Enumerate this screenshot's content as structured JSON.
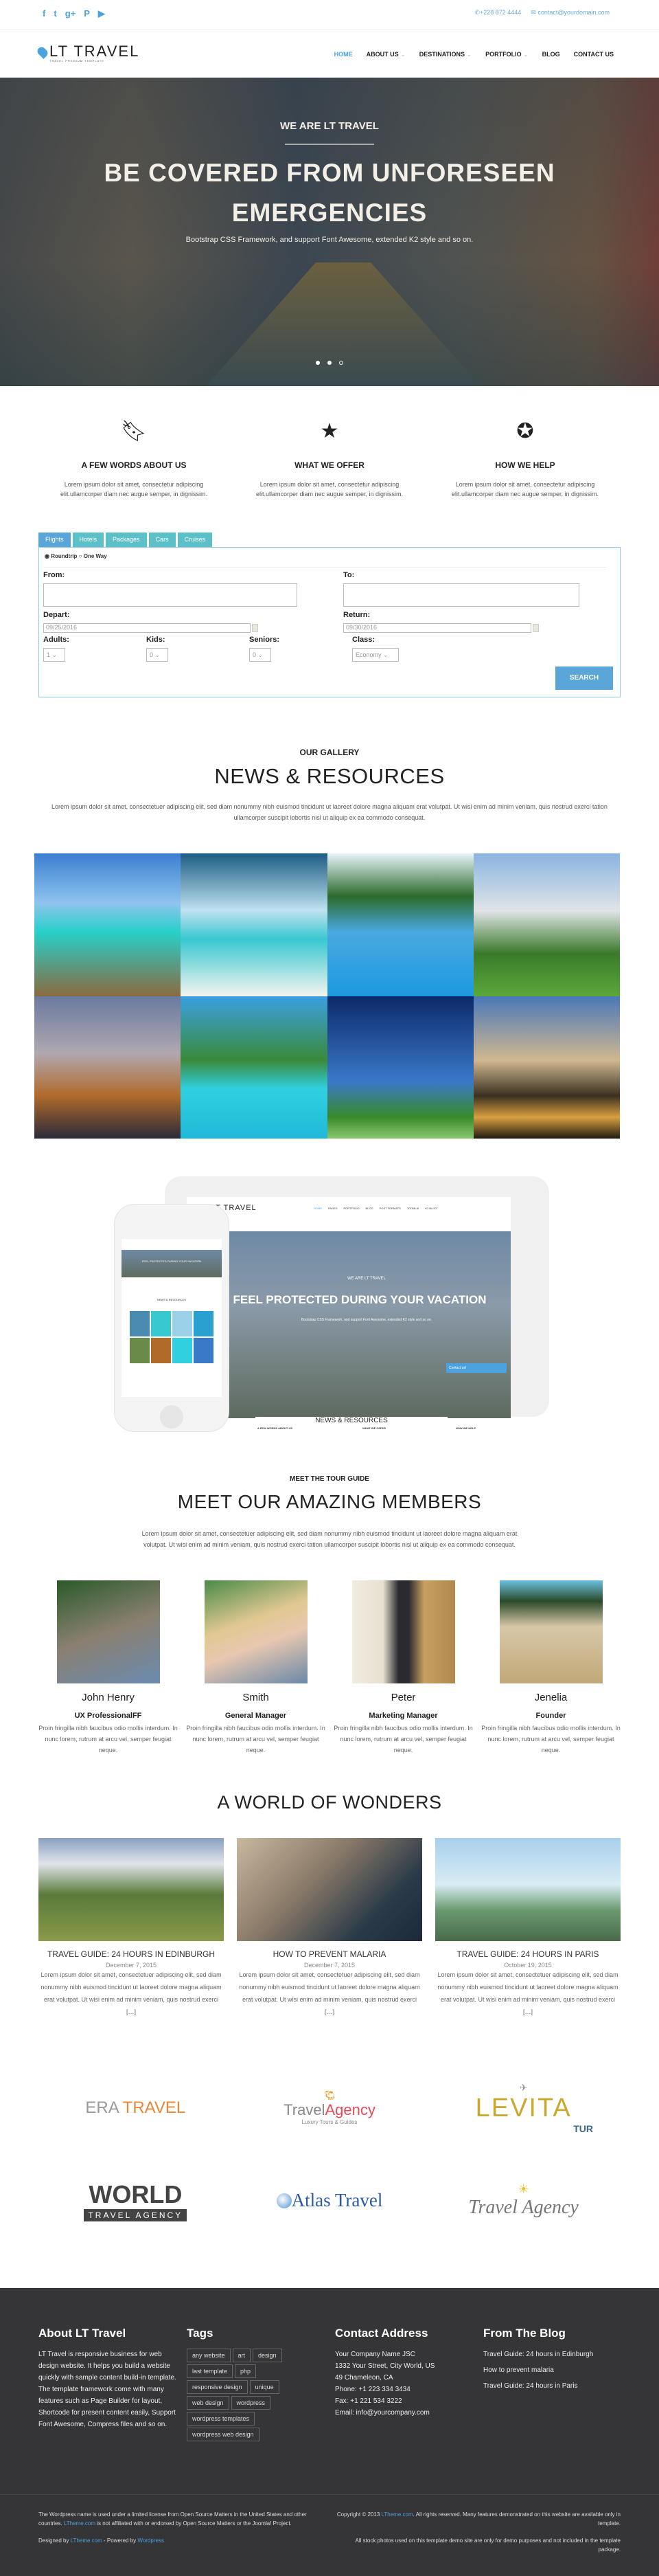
{
  "topbar": {
    "social": [
      "facebook-icon",
      "twitter-icon",
      "google-plus-icon",
      "pinterest-icon",
      "youtube-icon"
    ],
    "phone": "+228 872 4444",
    "email": "contact@yourdomain.com"
  },
  "nav": {
    "logo_text": "LT TRAVEL",
    "logo_tagline": "TRAVEL PREMIUM TEMPLATE",
    "items": [
      {
        "label": "HOME",
        "active": true
      },
      {
        "label": "ABOUT US",
        "dropdown": true
      },
      {
        "label": "DESTINATIONS",
        "dropdown": true
      },
      {
        "label": "PORTFOLIO",
        "dropdown": true
      },
      {
        "label": "BLOG"
      },
      {
        "label": "CONTACT US"
      }
    ]
  },
  "hero": {
    "kicker": "WE ARE LT TRAVEL",
    "title_line1": "BE COVERED FROM UNFORESEEN",
    "title_line2": "EMERGENCIES",
    "subtitle": "Bootstrap CSS Framework, and support Font Awesome, extended K2 style and so on.",
    "slides": 3,
    "active_slide": 3
  },
  "features": [
    {
      "icon": "bookmark-icon",
      "title": "A FEW WORDS ABOUT US",
      "text": "Lorem ipsum dolor sit amet, consectetur adipiscing elit.ullamcorper diam nec augue semper, in dignissim."
    },
    {
      "icon": "star-icon",
      "title": "WHAT WE OFFER",
      "text": "Lorem ipsum dolor sit amet, consectetur adipiscing elit.ullamcorper diam nec augue semper, in dignissim."
    },
    {
      "icon": "rebel-icon",
      "title": "HOW WE HELP",
      "text": "Lorem ipsum dolor sit amet, consectetur adipiscing elit.ullamcorper diam nec augue semper, in dignissim."
    }
  ],
  "search": {
    "tabs": [
      "Flights",
      "Hotels",
      "Packages",
      "Cars",
      "Cruises"
    ],
    "active_tab": "Flights",
    "trip_roundtrip": "Roundtrip",
    "trip_oneway": "One Way",
    "trip_selected": "Roundtrip",
    "from_label": "From:",
    "from_value": "",
    "to_label": "To:",
    "to_value": "",
    "depart_label": "Depart:",
    "depart_value": "09/25/2016",
    "return_label": "Return:",
    "return_value": "09/30/2016",
    "adults_label": "Adults:",
    "adults_value": "1",
    "kids_label": "Kids:",
    "kids_value": "0",
    "seniors_label": "Seniors:",
    "seniors_value": "0",
    "class_label": "Class:",
    "class_value": "Economy",
    "button": "SEARCH"
  },
  "gallery": {
    "kicker": "OUR GALLERY",
    "title": "NEWS & RESOURCES",
    "text": "Lorem ipsum dolor sit amet, consectetuer adipiscing elit, sed diam nonummy nibh euismod tincidunt ut laoreet dolore magna aliquam erat volutpat. Ut wisi enim ad minim veniam, quis nostrud exerci tation ullamcorper suscipit lobortis nisl ut aliquip ex ea commodo consequat.",
    "images": [
      "beach-pier",
      "longtail-boat",
      "resort-pool",
      "chateau",
      "city-tower",
      "island-huts",
      "eiffel-tower",
      "westminster"
    ]
  },
  "mockup": {
    "logo": "LT TRAVEL",
    "menu": [
      "HOME",
      "PAGES",
      "PORTFOLIO",
      "BLOG",
      "POST FORMATS",
      "JOOMLA!",
      "K2 BLOG"
    ],
    "kicker": "WE ARE LT TRAVEL",
    "title": "FEEL PROTECTED DURING YOUR VACATION",
    "subtitle": "Bootstrap CSS Framework, and support Font Awesome, extended K2 style and so on.",
    "contact_button": "Contact us!",
    "features": [
      "A FEW WORDS ABOUT US",
      "WHAT WE OFFER",
      "HOW WE HELP"
    ],
    "gallery_kicker": "OUR GALLERY",
    "gallery_title": "NEWS & RESOURCES"
  },
  "team": {
    "kicker": "MEET THE TOUR GUIDE",
    "title": "MEET OUR AMAZING MEMBERS",
    "text": "Lorem ipsum dolor sit amet, consectetuer adipiscing elit, sed diam nonummy nibh euismod tincidunt ut laoreet dolore magna aliquam erat volutpat. Ut wisi enim ad minim veniam, quis nostrud exerci tation ullamcorper suscipit lobortis nisl ut aliquip ex ea commodo consequat.",
    "members": [
      {
        "name": "John Henry",
        "role": "UX ProfessionalFF",
        "bio": "Proin fringilla nibh faucibus odio mollis interdum. In nunc lorem, rutrum at arcu vel, semper feugiat neque."
      },
      {
        "name": "Smith",
        "role": "General Manager",
        "bio": "Proin fringilla nibh faucibus odio mollis interdum. In nunc lorem, rutrum at arcu vel, semper feugiat neque."
      },
      {
        "name": "Peter",
        "role": "Marketing Manager",
        "bio": "Proin fringilla nibh faucibus odio mollis interdum. In nunc lorem, rutrum at arcu vel, semper feugiat neque."
      },
      {
        "name": "Jenelia",
        "role": "Founder",
        "bio": "Proin fringilla nibh faucibus odio mollis interdum. In nunc lorem, rutrum at arcu vel, semper feugiat neque."
      }
    ]
  },
  "blog": {
    "title": "A WORLD OF WONDERS",
    "posts": [
      {
        "title": "TRAVEL GUIDE: 24 HOURS IN EDINBURGH",
        "date": "December 7, 2015",
        "excerpt": "Lorem ipsum dolor sit amet, consectetuer adipiscing elit, sed diam nonummy nibh euismod tincidunt ut laoreet dolore magna aliquam erat volutpat. Ut wisi enim ad minim veniam, quis nostrud exerci […]"
      },
      {
        "title": "HOW TO PREVENT MALARIA",
        "date": "December 7, 2015",
        "excerpt": "Lorem ipsum dolor sit amet, consectetuer adipiscing elit, sed diam nonummy nibh euismod tincidunt ut laoreet dolore magna aliquam erat volutpat. Ut wisi enim ad minim veniam, quis nostrud exerci […]"
      },
      {
        "title": "TRAVEL GUIDE: 24 HOURS IN PARIS",
        "date": "October 19, 2015",
        "excerpt": "Lorem ipsum dolor sit amet, consectetuer adipiscing elit, sed diam nonummy nibh euismod tincidunt ut laoreet dolore magna aliquam erat volutpat. Ut wisi enim ad minim veniam, quis nostrud exerci […]"
      }
    ]
  },
  "partners": [
    {
      "a": "ERA ",
      "b": "TRAVEL"
    },
    {
      "a": "Travel",
      "b": "Agency",
      "sub": "Luxury Tours & Guides"
    },
    {
      "a": "LEVITA",
      "b": "TUR"
    },
    {
      "a": "WORLD",
      "b": "TRAVEL AGENCY"
    },
    {
      "a": "Atlas Travel"
    },
    {
      "a": "Travel Agency"
    }
  ],
  "footer": {
    "about_title": "About LT Travel",
    "about_text": "LT Travel is responsive business for web design website. It helps you build a website quickly with sample content build-in template. The template framework come with many features such as Page Builder for layout, Shortcode for present content easily, Support Font Awesome, Compress files and so on.",
    "tags_title": "Tags",
    "tags": [
      "any website",
      "art",
      "design",
      "last template",
      "php",
      "responsive design",
      "unique",
      "web design",
      "wordpress",
      "wordpress templates",
      "wordpress web design"
    ],
    "contact_title": "Contact Address",
    "contact_lines": [
      "Your Company Name JSC",
      "1332 Your Street, City World, US",
      "49 Chameleon, CA",
      "Phone: +1 223 334 3434",
      "Fax: +1 221 534 3222",
      "Email: info@yourcompany.com"
    ],
    "blog_title": "From The Blog",
    "blog_links": [
      "Travel Guide: 24 hours in Edinburgh",
      "How to prevent malaria",
      "Travel Guide: 24 hours in Paris"
    ],
    "legal_1a": "The Wordpress name is used under a limited license from Open Source Matters in the United States and other countries. ",
    "legal_1link": "LTheme.com",
    "legal_1b": " is not affiliated with or endorsed by Open Source Matters or the Joomla! Project.",
    "designed_by": "Designed by ",
    "designed_link": "LTheme.com",
    "powered_by": " - Powered by ",
    "powered_link": "Wordpress",
    "copyright_a": "Copyright © 2013 ",
    "copyright_link": "LTheme.com",
    "copyright_b": ". All rights reserved. Many features demonstrated on this website are available only in template.",
    "stock_note": "All stock photos used on this template demo site are only for demo purposes and not included in the template package."
  },
  "colors": {
    "accent": "#4aa3df",
    "tab": "#5bc0c8",
    "footer_bg": "#353537"
  }
}
